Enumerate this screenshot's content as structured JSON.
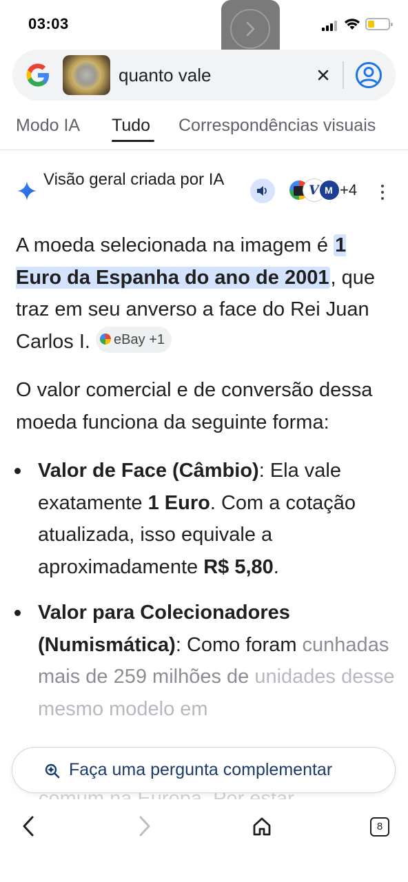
{
  "status_bar": {
    "time": "03:03"
  },
  "search": {
    "query": "quanto vale"
  },
  "tabs": [
    {
      "label": "Modo IA"
    },
    {
      "label": "Tudo"
    },
    {
      "label": "Correspondências visuais"
    }
  ],
  "ai_overview": {
    "title": "Visão geral criada por IA",
    "sources_more": "+4",
    "source_icon_letter": "V",
    "source_icon_text": "M"
  },
  "answer": {
    "p1_before": "A moeda selecionada na imagem é ",
    "p1_highlight": "1 Euro da Espanha do ano de 2001",
    "p1_after": ", que traz em seu anverso a face do Rei Juan Carlos I.",
    "p1_chip": "eBay +1",
    "p2": "O valor comercial e de conversão dessa moeda funciona da seguinte forma:",
    "b1_bold": "Valor de Face (Câmbio)",
    "b1_text1": ": Ela vale exatamente ",
    "b1_bold2": "1 Euro",
    "b1_text2": ". Com a cotação atualizada, isso equivale a aproximadamente ",
    "b1_bold3": "R$ 5,80",
    "b1_text3": ".",
    "b2_bold": "Valor para Colecionadores (Numismática)",
    "b2_text1": ": Como foram ",
    "b2_text2": "cunhadas mais de 259 milhões de ",
    "b2_text3": "unidades desse mesmo modelo em"
  },
  "followup": {
    "label": "Faça uma pergunta complementar"
  },
  "ghost_text": "comum na Europa. Por estar",
  "bottom_nav": {
    "tab_count": "8"
  },
  "colors": {
    "accent": "#1a73e8",
    "highlight": "#d3e3fd",
    "followup_text": "#1a3a6e"
  }
}
